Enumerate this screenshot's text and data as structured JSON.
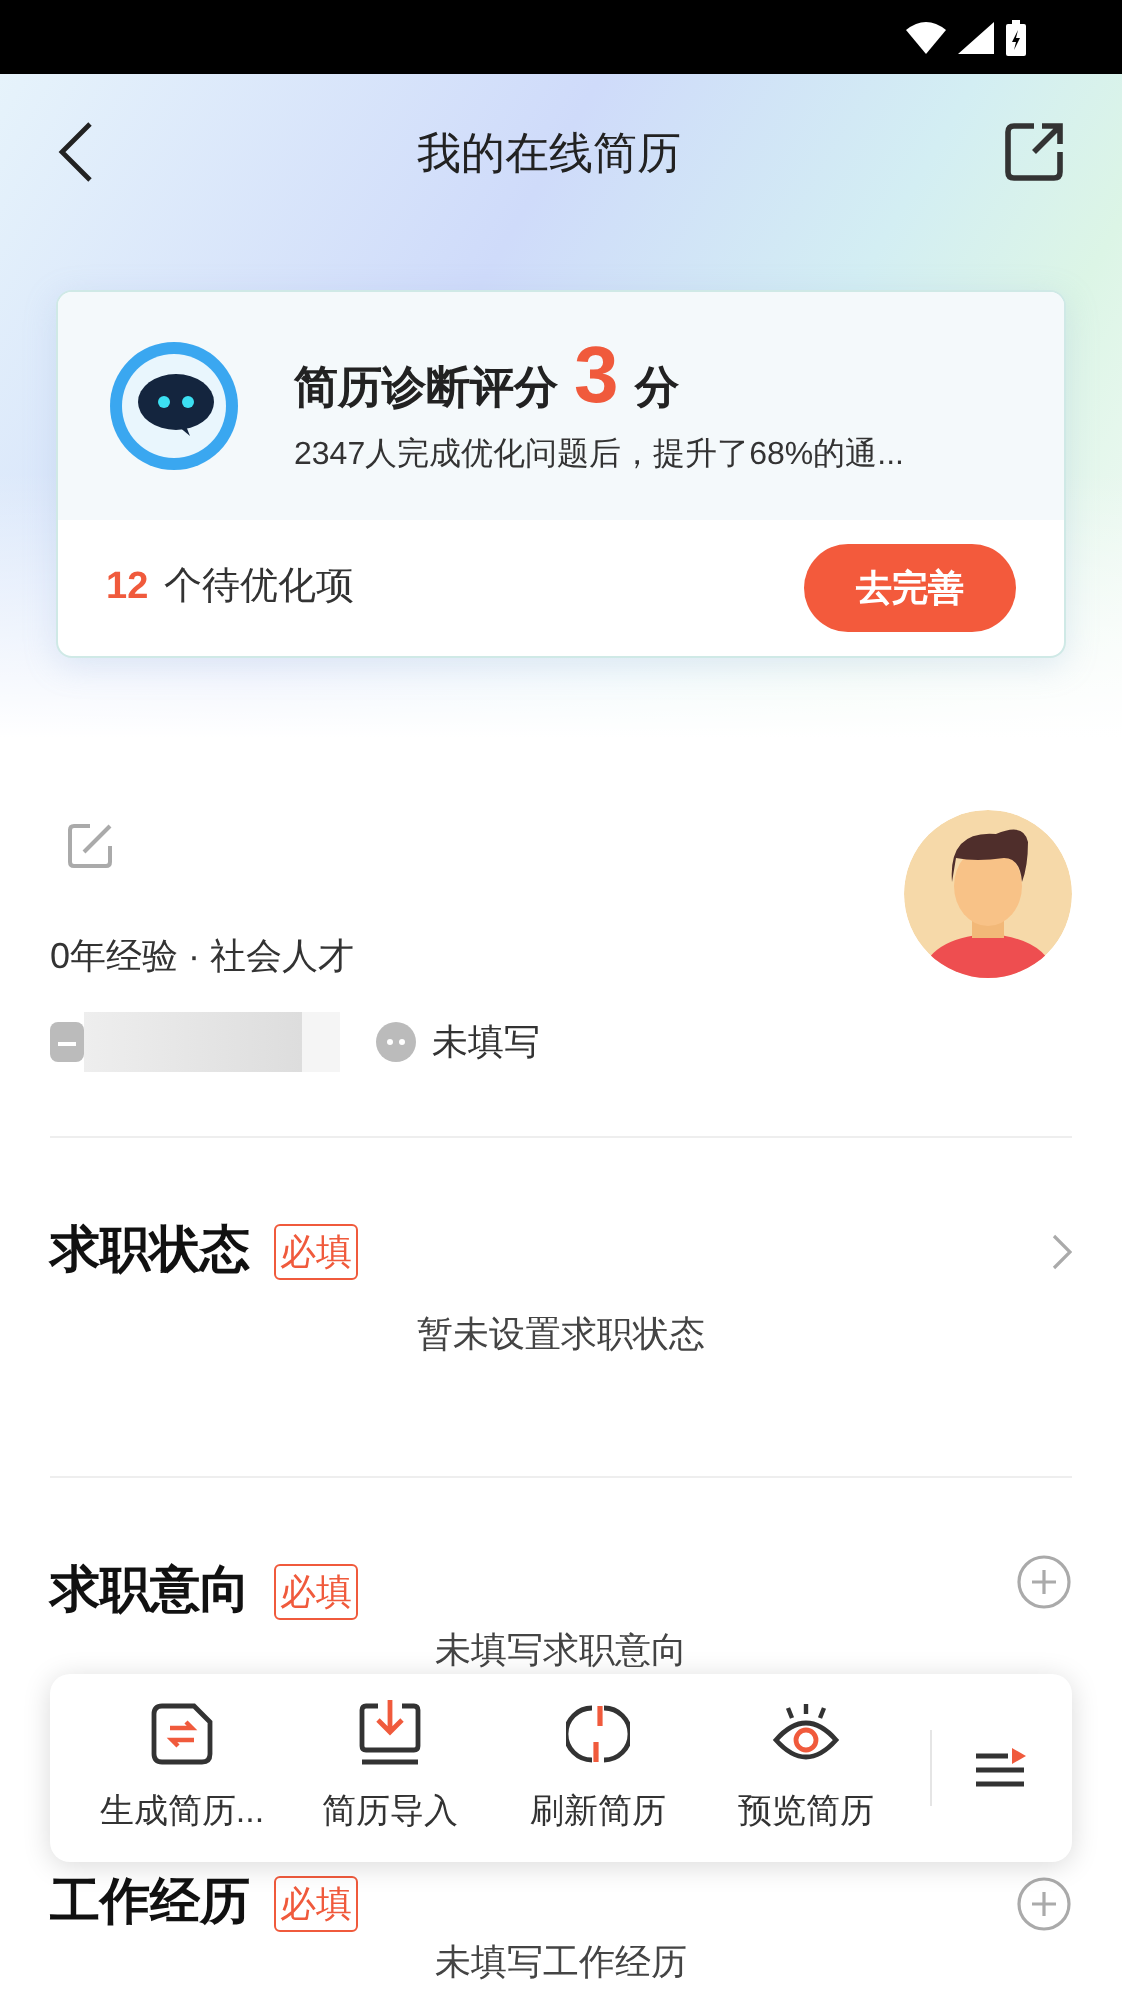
{
  "header": {
    "title": "我的在线简历"
  },
  "diagnosis": {
    "title": "简历诊断评分",
    "score": "3",
    "unit": "分",
    "description": "2347人完成优化问题后，提升了68%的通...",
    "pending_count": "12",
    "pending_label": "个待优化项",
    "button": "去完善"
  },
  "profile": {
    "summary": "0年经验 · 社会人才",
    "wechat": "未填写"
  },
  "sections": [
    {
      "title": "求职状态",
      "badge": "必填",
      "kind": "chevron",
      "empty_text": "暂未设置求职状态"
    },
    {
      "title": "求职意向",
      "badge": "必填",
      "kind": "add",
      "empty_text": "未填写求职意向"
    },
    {
      "title": "工作经历",
      "badge": "必填",
      "kind": "add",
      "empty_text": "未填写工作经历"
    }
  ],
  "toolbar": {
    "items": [
      {
        "label": "生成简历...",
        "kind": "generate"
      },
      {
        "label": "简历导入",
        "kind": "import"
      },
      {
        "label": "刷新简历",
        "kind": "refresh"
      },
      {
        "label": "预览简历",
        "kind": "preview"
      }
    ]
  }
}
